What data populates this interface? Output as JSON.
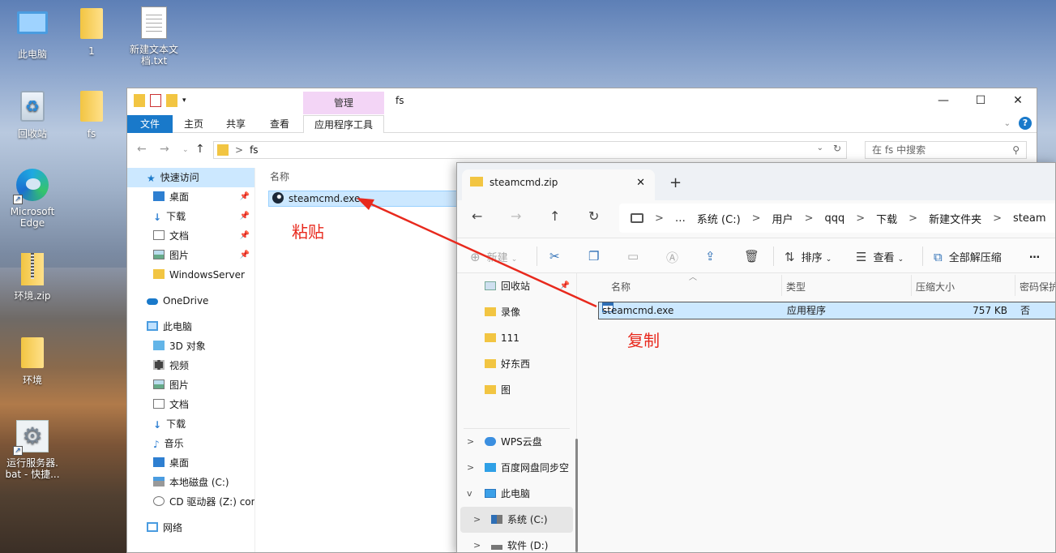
{
  "desktop": {
    "icons": [
      {
        "label": "此电脑",
        "icon": "computer-icon"
      },
      {
        "label": "1",
        "icon": "folder-icon"
      },
      {
        "label": "新建文本文档.txt",
        "icon": "text-file-icon"
      },
      {
        "label": "回收站",
        "icon": "recycle-bin-icon"
      },
      {
        "label": "fs",
        "icon": "folder-icon"
      },
      {
        "label": "Microsoft Edge",
        "icon": "edge-icon"
      },
      {
        "label": "环境.zip",
        "icon": "zip-folder-icon"
      },
      {
        "label": "环境",
        "icon": "folder-icon"
      },
      {
        "label": "运行服务器.bat - 快捷...",
        "icon": "batch-shortcut-icon"
      }
    ]
  },
  "explorer": {
    "title": "fs",
    "context_tab": "管理",
    "ribbon_tabs": [
      "文件",
      "主页",
      "共享",
      "查看",
      "应用程序工具"
    ],
    "address": "fs",
    "address_sep": ">",
    "search_placeholder": "在 fs 中搜索",
    "nav_items": [
      {
        "label": "快速访问",
        "icon": "star-icon",
        "selected": true
      },
      {
        "label": "桌面",
        "icon": "desktop-icon",
        "pinned": true
      },
      {
        "label": "下载",
        "icon": "download-icon",
        "pinned": true
      },
      {
        "label": "文档",
        "icon": "documents-icon",
        "pinned": true
      },
      {
        "label": "图片",
        "icon": "pictures-icon",
        "pinned": true
      },
      {
        "label": "WindowsServer",
        "icon": "folder-icon"
      },
      {
        "label": "OneDrive",
        "icon": "cloud-icon"
      },
      {
        "label": "此电脑",
        "icon": "computer-icon"
      },
      {
        "label": "3D 对象",
        "icon": "3d-objects-icon"
      },
      {
        "label": "视频",
        "icon": "video-icon"
      },
      {
        "label": "图片",
        "icon": "pictures-icon"
      },
      {
        "label": "文档",
        "icon": "documents-icon"
      },
      {
        "label": "下载",
        "icon": "download-icon"
      },
      {
        "label": "音乐",
        "icon": "music-icon"
      },
      {
        "label": "桌面",
        "icon": "desktop-icon"
      },
      {
        "label": "本地磁盘 (C:)",
        "icon": "drive-icon"
      },
      {
        "label": "CD 驱动器 (Z:) con",
        "icon": "cd-drive-icon"
      },
      {
        "label": "网络",
        "icon": "network-icon"
      }
    ],
    "column_name": "名称",
    "file": {
      "name": "steamcmd.exe",
      "icon": "steam-icon"
    }
  },
  "zip_window": {
    "tab_title": "steamcmd.zip",
    "new_tab": "+",
    "breadcrumb": [
      "…",
      "系统 (C:)",
      "用户",
      "qqq",
      "下载",
      "新建文件夹",
      "steam"
    ],
    "breadcrumb_sep": ">",
    "commands": {
      "new": "新建",
      "sort": "排序",
      "view": "查看",
      "extract_all": "全部解压缩",
      "more": "…"
    },
    "nav_items": [
      {
        "label": "回收站",
        "icon": "recycle-bin-icon",
        "pinned": true
      },
      {
        "label": "录像",
        "icon": "folder-icon"
      },
      {
        "label": "111",
        "icon": "folder-icon"
      },
      {
        "label": "好东西",
        "icon": "folder-icon"
      },
      {
        "label": "图",
        "icon": "folder-icon"
      },
      {
        "label": "WPS云盘",
        "icon": "wps-cloud-icon",
        "chevron": ">"
      },
      {
        "label": "百度网盘同步空",
        "icon": "baidu-netdisk-icon",
        "chevron": ">"
      },
      {
        "label": "此电脑",
        "icon": "computer-icon",
        "chevron": "v"
      },
      {
        "label": "系统 (C:)",
        "icon": "windows-drive-icon",
        "chevron": ">",
        "selected": true
      },
      {
        "label": "软件 (D:)",
        "icon": "drive-icon",
        "chevron": ">"
      }
    ],
    "columns": [
      "名称",
      "类型",
      "压缩大小",
      "密码保护"
    ],
    "file": {
      "name": "steamcmd.exe",
      "type": "应用程序",
      "size": "757 KB",
      "password": "否"
    }
  },
  "annotations": {
    "paste": "粘贴",
    "copy": "复制",
    "color": "#e8291d"
  }
}
